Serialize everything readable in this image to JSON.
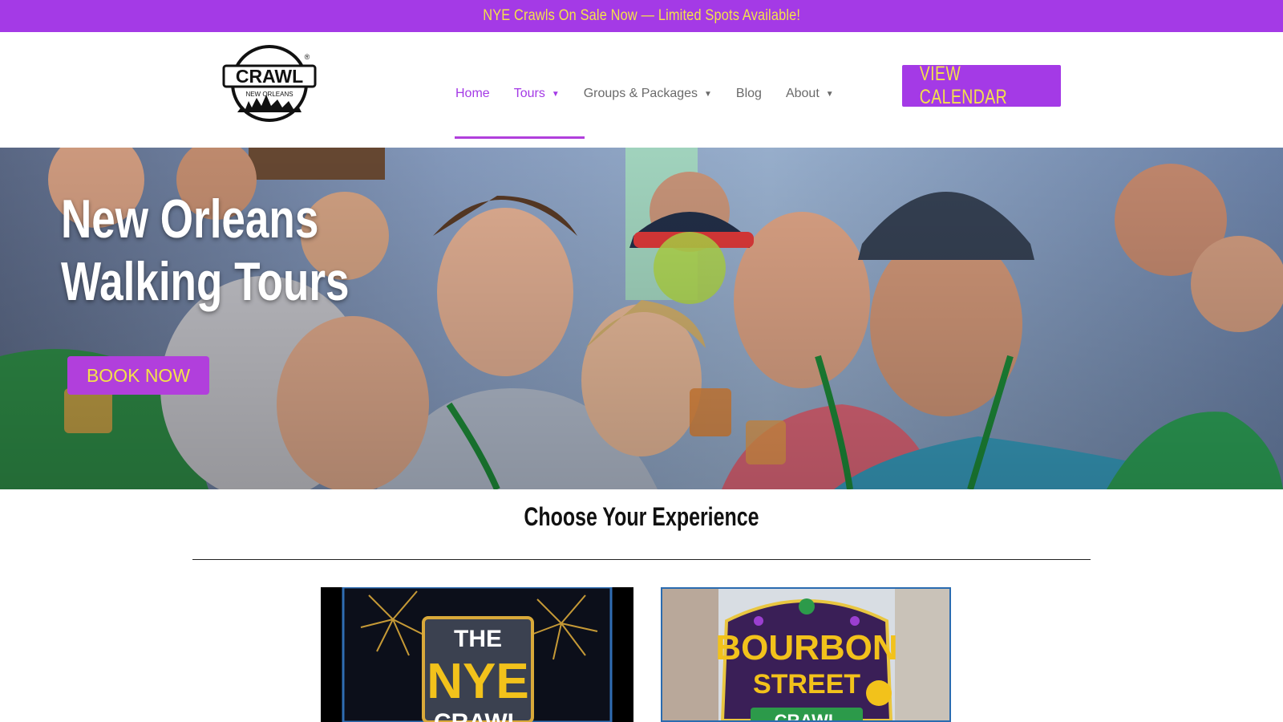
{
  "announcement": "NYE Crawls On Sale Now — Limited Spots Available!",
  "logo": {
    "main_text": "CRAWL",
    "sub_text": "NEW ORLEANS",
    "mark": "®"
  },
  "nav": {
    "items": [
      {
        "label": "Home",
        "active": true,
        "has_dropdown": false
      },
      {
        "label": "Tours",
        "active": true,
        "has_dropdown": true
      },
      {
        "label": "Groups & Packages",
        "active": false,
        "has_dropdown": true
      },
      {
        "label": "Blog",
        "active": false,
        "has_dropdown": false
      },
      {
        "label": "About",
        "active": false,
        "has_dropdown": true
      }
    ]
  },
  "calendar_button": "VIEW CALENDAR",
  "hero": {
    "title_line1": "New Orleans",
    "title_line2": "Walking Tours",
    "cta": "BOOK NOW"
  },
  "section": {
    "title": "Choose Your Experience"
  },
  "cards": [
    {
      "line1": "THE",
      "line2": "NYE",
      "line3": "CRAWL"
    },
    {
      "line1": "BOURBON",
      "line2": "STREET",
      "line3": "CRAWL"
    }
  ],
  "colors": {
    "brand_purple": "#a43ae6",
    "accent_yellow": "#f3e24a",
    "nav_gray": "#6a6a6a"
  }
}
